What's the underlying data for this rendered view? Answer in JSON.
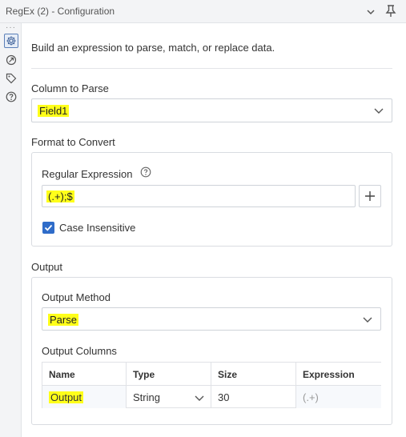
{
  "window": {
    "title": "RegEx (2) - Configuration"
  },
  "sidebar": {
    "more_glyph": "···"
  },
  "intro": "Build an expression to parse, match, or replace data.",
  "column_to_parse": {
    "label": "Column to Parse",
    "value": "Field1"
  },
  "format_to_convert": {
    "label": "Format to Convert",
    "regex_label": "Regular Expression",
    "regex_value": "(.+);$",
    "case_insensitive": {
      "label": "Case Insensitive",
      "checked": true
    }
  },
  "output": {
    "label": "Output",
    "method_label": "Output Method",
    "method_value": "Parse",
    "columns_label": "Output Columns",
    "table": {
      "headers": [
        "Name",
        "Type",
        "Size",
        "Expression"
      ],
      "rows": [
        [
          "Output",
          "String",
          "30",
          "(.+)"
        ]
      ]
    }
  },
  "colors": {
    "highlight": "#ffff1a",
    "accent": "#2f6cc9"
  }
}
